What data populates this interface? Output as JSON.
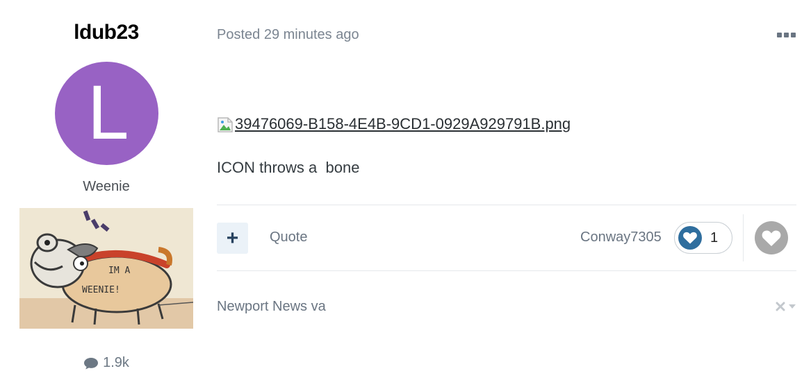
{
  "author": {
    "username": "ldub23",
    "avatar_letter": "L",
    "avatar_color": "#9862c4",
    "group": "Weenie",
    "group_image_text_1": "IM A",
    "group_image_text_2": "WEENIE!",
    "post_count": "1.9k",
    "post_count_icon": "speech-bubble-icon"
  },
  "post": {
    "posted": "Posted 29 minutes ago",
    "more_icon": "ellipsis-icon",
    "image_link": "39476069-B158-4E4B-9CD1-0929A929791B.png",
    "body": "ICON throws a  bone"
  },
  "actions": {
    "multiquote_label": "+",
    "quote_label": "Quote",
    "reactor_name": "Conway7305",
    "reaction_icon": "heart-icon",
    "reaction_count": "1",
    "reaction_color": "#2f6e9e",
    "like_icon": "heart-icon"
  },
  "footer": {
    "location": "Newport News va",
    "report_icon": "close-dropdown-icon"
  }
}
